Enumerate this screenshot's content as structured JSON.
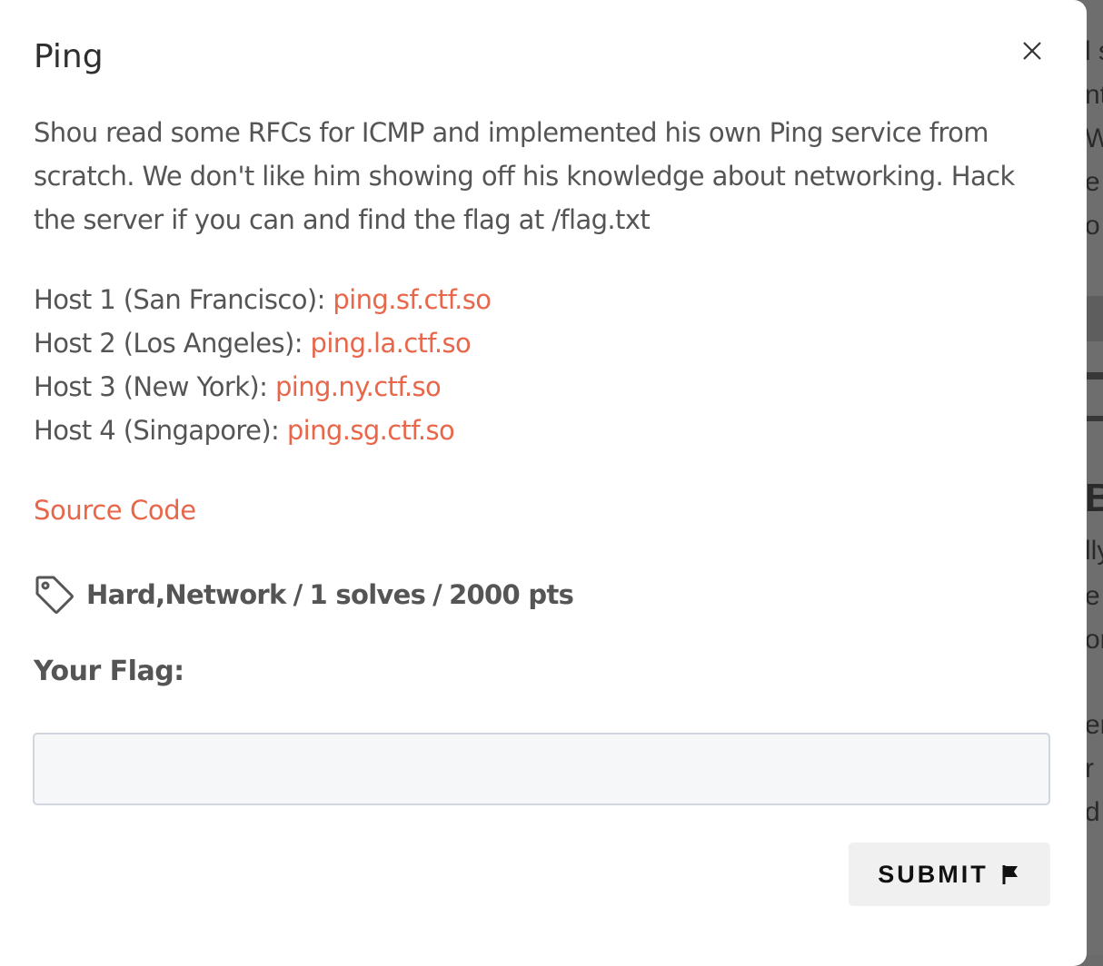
{
  "modal": {
    "title": "Ping",
    "description": "Shou read some RFCs for ICMP and implemented his own Ping service from scratch. We don't like him showing off his knowledge about networking. Hack the server if you can and find the flag at /flag.txt",
    "hosts": [
      {
        "label": "Host 1 (San Francisco): ",
        "link": "ping.sf.ctf.so"
      },
      {
        "label": "Host 2 (Los Angeles): ",
        "link": "ping.la.ctf.so"
      },
      {
        "label": "Host 3 (New York): ",
        "link": "ping.ny.ctf.so"
      },
      {
        "label": "Host 4 (Singapore): ",
        "link": "ping.sg.ctf.so"
      }
    ],
    "source_link": "Source Code",
    "meta": {
      "tags": "Hard,Network",
      "separator": "/",
      "solves": "1 solves",
      "points": "2000 pts"
    },
    "flag_label": "Your Flag:",
    "flag_input": {
      "value": "",
      "placeholder": ""
    },
    "submit_label": "SUBMIT"
  },
  "icons": {
    "close": "close-icon",
    "tag": "tag-icon",
    "submit": "flag-icon"
  },
  "colors": {
    "link": "#e8664a",
    "text": "#555555",
    "input_bg": "#f5f7f9",
    "button_bg": "#f0f0f0"
  }
}
